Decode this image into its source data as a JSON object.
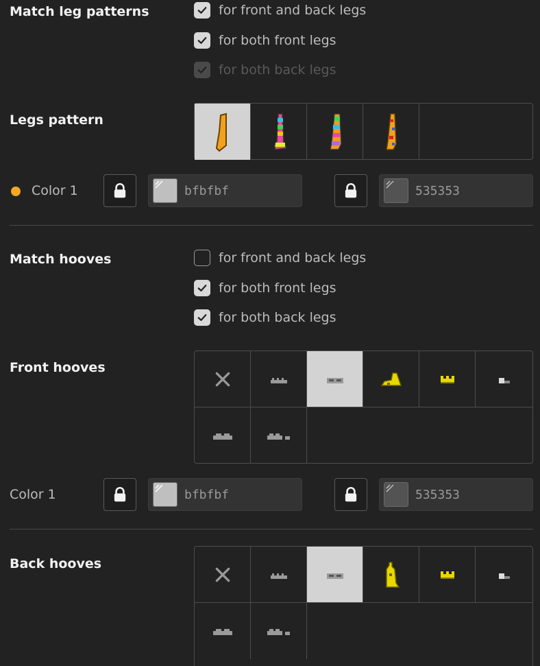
{
  "accent_color": "#f5a623",
  "match_leg_patterns": {
    "title": "Match leg patterns",
    "options": [
      {
        "label": "for front and back legs",
        "checked": true,
        "disabled": false
      },
      {
        "label": "for both front legs",
        "checked": true,
        "disabled": false
      },
      {
        "label": "for both back legs",
        "checked": true,
        "disabled": true
      }
    ]
  },
  "legs_pattern": {
    "title": "Legs pattern",
    "options": [
      {
        "icon": "plain-leg-icon",
        "selected": true
      },
      {
        "icon": "rainbow-stripe-leg-icon",
        "selected": false
      },
      {
        "icon": "rainbow-diagonal-leg-icon",
        "selected": false
      },
      {
        "icon": "spotted-leg-icon",
        "selected": false
      }
    ]
  },
  "legs_color": {
    "label": "Color 1",
    "primary": {
      "hex": "bfbfbf",
      "swatch": "#bfbfbf"
    },
    "secondary": {
      "hex": "535353",
      "swatch": "#535353"
    }
  },
  "match_hooves": {
    "title": "Match hooves",
    "options": [
      {
        "label": "for front and back legs",
        "checked": false,
        "disabled": false
      },
      {
        "label": "for both front legs",
        "checked": true,
        "disabled": false
      },
      {
        "label": "for both back legs",
        "checked": true,
        "disabled": false
      }
    ]
  },
  "front_hooves": {
    "title": "Front hooves",
    "options": [
      {
        "icon": "none-x-icon",
        "selected": false
      },
      {
        "icon": "hoof-small-icon",
        "selected": false
      },
      {
        "icon": "hoof-double-icon",
        "selected": true
      },
      {
        "icon": "yellow-boot-icon",
        "selected": false
      },
      {
        "icon": "yellow-crown-hoof-icon",
        "selected": false
      },
      {
        "icon": "small-grey-hoof-icon",
        "selected": false
      },
      {
        "icon": "hoof-wide-icon",
        "selected": false
      },
      {
        "icon": "hoof-split-icon",
        "selected": false
      }
    ]
  },
  "hooves_color": {
    "label": "Color 1",
    "primary": {
      "hex": "bfbfbf",
      "swatch": "#bfbfbf"
    },
    "secondary": {
      "hex": "535353",
      "swatch": "#535353"
    }
  },
  "back_hooves": {
    "title": "Back hooves",
    "options": [
      {
        "icon": "none-x-icon",
        "selected": false
      },
      {
        "icon": "hoof-small-icon",
        "selected": false
      },
      {
        "icon": "hoof-double-icon",
        "selected": true
      },
      {
        "icon": "yellow-tall-boot-icon",
        "selected": false
      },
      {
        "icon": "yellow-crown-hoof-icon",
        "selected": false
      },
      {
        "icon": "small-grey-hoof-icon",
        "selected": false
      },
      {
        "icon": "hoof-wide-icon",
        "selected": false
      },
      {
        "icon": "hoof-split-icon",
        "selected": false
      }
    ]
  }
}
